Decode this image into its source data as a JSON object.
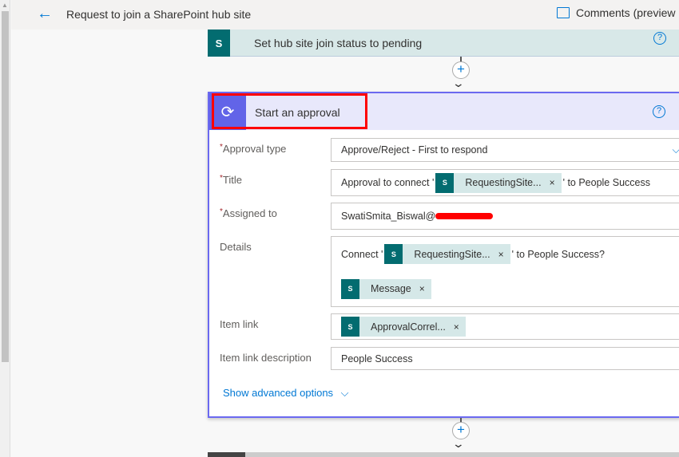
{
  "header": {
    "back_icon": "arrow-left-icon",
    "title": "Request to join a SharePoint hub site",
    "comments_label": "Comments (preview"
  },
  "previous_step": {
    "title": "Set hub site join status to pending",
    "icon_letter": "S",
    "help": "?"
  },
  "approval": {
    "title": "Start an approval",
    "help": "?",
    "fields": {
      "approval_type": {
        "label": "Approval type",
        "value": "Approve/Reject - First to respond"
      },
      "title": {
        "label": "Title",
        "prefix": "Approval to connect '",
        "token": "RequestingSite...",
        "suffix": "' to People Success"
      },
      "assigned_to": {
        "label": "Assigned to",
        "value": "SwatiSmita_Biswal@"
      },
      "details": {
        "label": "Details",
        "prefix": "Connect '",
        "token": "RequestingSite...",
        "suffix": "' to People Success?",
        "token2": "Message"
      },
      "item_link": {
        "label": "Item link",
        "token": "ApprovalCorrel..."
      },
      "item_link_description": {
        "label": "Item link description",
        "value": "People Success"
      }
    },
    "required_mark": "*",
    "remove": "×",
    "show_advanced": "Show advanced options"
  },
  "connector": {
    "plus": "+"
  },
  "colors": {
    "sharepoint": "#036c70",
    "approval": "#6264e8",
    "accent": "#0078d4",
    "highlight": "#ff0000"
  }
}
